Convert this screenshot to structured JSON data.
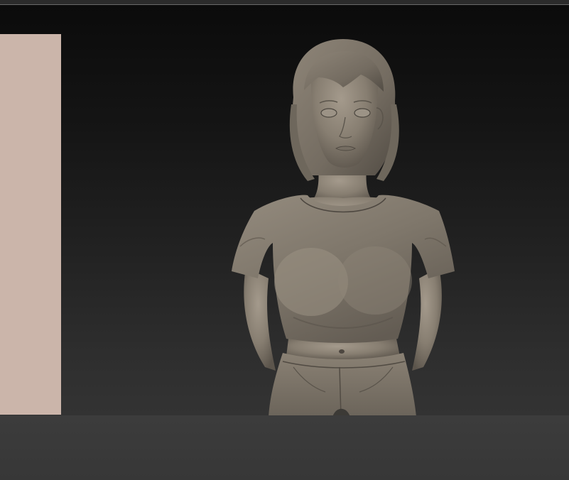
{
  "app": {
    "title": ""
  },
  "viewport": {
    "background_top": "#0b0b0b",
    "background_bottom": "#333333",
    "model_material_color": "#8b8275"
  },
  "material_swatch": {
    "color": "#cbb5aa"
  },
  "icons": {
    "model": "sculpt-bust"
  }
}
